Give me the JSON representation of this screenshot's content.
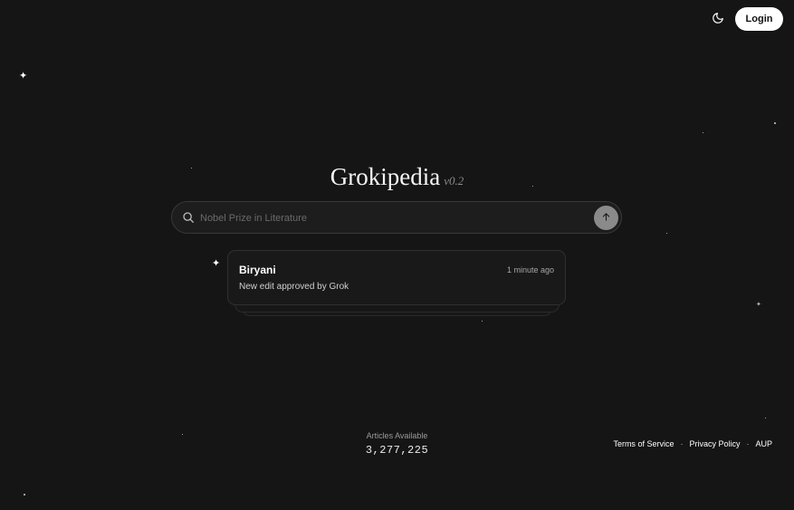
{
  "header": {
    "theme_icon": "moon-icon",
    "login_label": "Login"
  },
  "brand": {
    "title": "Grokipedia",
    "version": "v0.2"
  },
  "search": {
    "placeholder": "Nobel Prize in Literature",
    "value": "",
    "search_icon": "search-icon",
    "submit_icon": "arrow-up-icon"
  },
  "recent_edit": {
    "title": "Biryani",
    "time": "1 minute ago",
    "description": "New edit approved by Grok"
  },
  "stats": {
    "label": "Articles Available",
    "count": "3,277,225"
  },
  "footer": {
    "links": [
      "Terms of Service",
      "Privacy Policy",
      "AUP"
    ],
    "separator": "·"
  },
  "colors": {
    "background": "#151515",
    "text": "#f2f2f2",
    "login_bg": "#ffffff",
    "submit_btn": "#8a8a8a"
  }
}
